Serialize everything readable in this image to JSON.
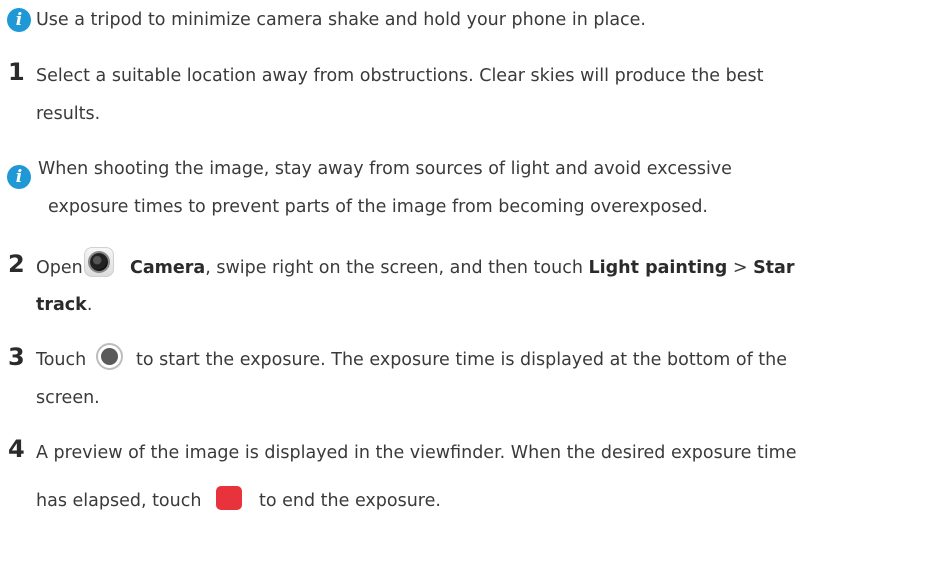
{
  "note1": {
    "icon": "info-icon",
    "glyph": "i",
    "text": "Use a tripod to minimize camera shake and hold your phone in place."
  },
  "step1": {
    "number": "1",
    "line1": "Select a suitable location away from obstructions. Clear skies will produce the best",
    "line2": "results."
  },
  "note2": {
    "icon": "info-icon",
    "glyph": "i",
    "line1": "When shooting the image, stay away from sources of light and avoid excessive",
    "line2": "exposure times to prevent parts of the image from becoming overexposed."
  },
  "step2": {
    "number": "2",
    "open": "Open",
    "app_icon": "camera-app-icon",
    "camera": "Camera",
    "mid": ", swipe right on the screen, and then touch",
    "light_painting": "Light painting",
    "sep": ">",
    "star": "Star",
    "track": "track",
    "end": "."
  },
  "step3": {
    "number": "3",
    "touch": "Touch",
    "icon": "shutter-button-icon",
    "rest": "to start the exposure. The exposure time is displayed at the bottom of the",
    "line2": "screen."
  },
  "step4": {
    "number": "4",
    "line1": "A preview of the image is displayed in the viewfinder. When the desired exposure time",
    "pre": "has elapsed, touch",
    "icon": "stop-button-icon",
    "post": "to end the exposure."
  },
  "colors": {
    "info": "#1f98d6",
    "stop": "#e8323c",
    "text": "#3a3a3a"
  }
}
